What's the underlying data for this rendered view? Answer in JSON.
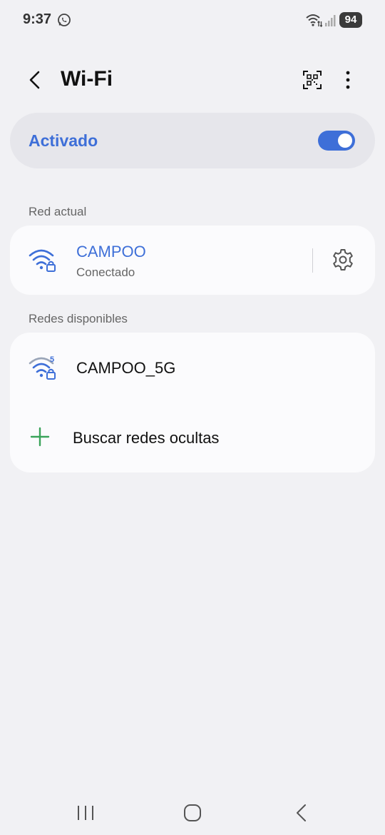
{
  "status_bar": {
    "time": "9:37",
    "battery": "94",
    "icons": [
      "whatsapp-icon",
      "wifi-data-icon",
      "signal-icon"
    ]
  },
  "header": {
    "title": "Wi-Fi",
    "icons": [
      "back-arrow-icon",
      "qr-code-scan-icon",
      "more-options-icon"
    ]
  },
  "master_toggle": {
    "label": "Activado",
    "on": true
  },
  "current_network": {
    "section_label": "Red actual",
    "name": "CAMPOO",
    "status": "Conectado",
    "icons": [
      "wifi-lock-icon",
      "settings-gear-icon"
    ]
  },
  "available_networks": {
    "section_label": "Redes disponibles",
    "items": [
      {
        "name": "CAMPOO_5G",
        "band_badge": "5",
        "icon": "wifi-5g-lock-icon"
      }
    ],
    "add_network_label": "Buscar redes ocultas"
  },
  "nav_bar": {
    "icons": [
      "recent-apps-icon",
      "home-icon",
      "back-icon"
    ]
  },
  "colors": {
    "accent": "#3e6fd8",
    "background": "#f1f1f4",
    "card": "#fbfbfd",
    "add_icon": "#3aa35a"
  }
}
